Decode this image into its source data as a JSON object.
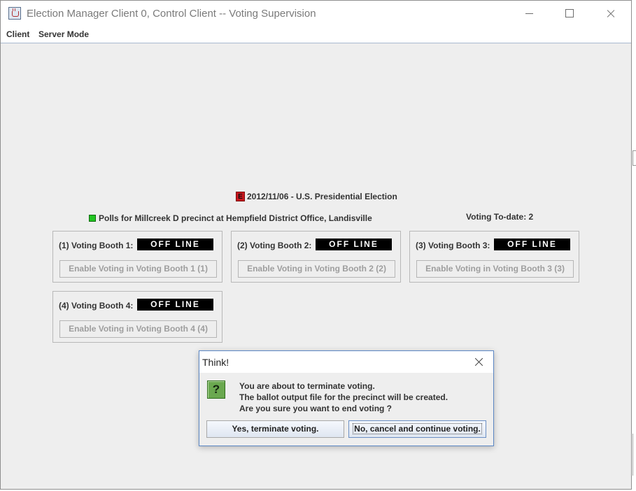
{
  "window": {
    "title": "Election Manager Client 0,  Control Client -- Voting Supervision"
  },
  "menu": {
    "items": [
      "Client",
      "Server Mode"
    ]
  },
  "election": {
    "title": "2012/11/06 - U.S. Presidential Election",
    "icon_letter": "E",
    "polls": "Polls for Millcreek D precinct at Hempfield District Office, Landisville",
    "voting_todate": "Voting To-date: 2"
  },
  "booths": [
    {
      "label": "(1) Voting Booth 1:",
      "status": "OFF LINE",
      "button": "Enable Voting in Voting Booth 1 (1)"
    },
    {
      "label": "(2) Voting Booth 2:",
      "status": "OFF LINE",
      "button": "Enable Voting in Voting Booth 2 (2)"
    },
    {
      "label": "(3) Voting Booth 3:",
      "status": "OFF LINE",
      "button": "Enable Voting in Voting Booth 3 (3)"
    },
    {
      "label": "(4) Voting Booth 4:",
      "status": "OFF LINE",
      "button": "Enable Voting in Voting Booth 4 (4)"
    }
  ],
  "dialog": {
    "title": "Think!",
    "icon": "question-icon",
    "icon_glyph": "?",
    "messages": [
      "You are about to terminate voting.",
      "The ballot output file for the precinct will be created.",
      "Are you sure you want to end voting ?"
    ],
    "yes_label": "Yes, terminate voting.",
    "no_label": "No, cancel and continue voting."
  },
  "colors": {
    "status_bg": "#000000",
    "polls_indicator": "#22c522",
    "election_icon": "#c8161e",
    "question_icon": "#6aa84f"
  }
}
